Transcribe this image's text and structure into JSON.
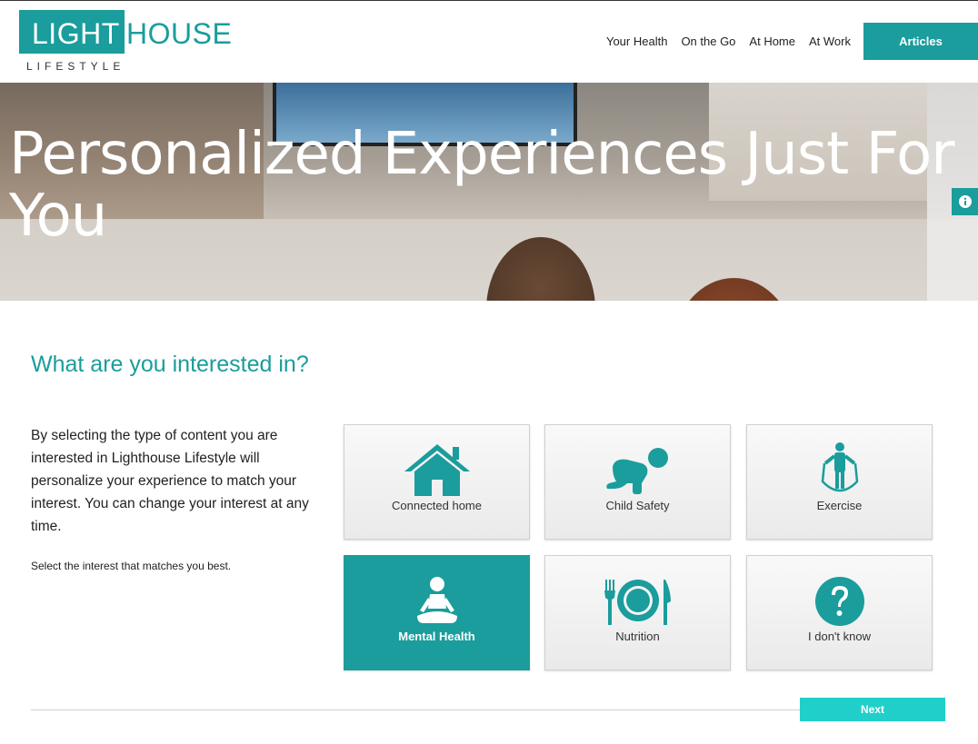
{
  "brand": {
    "logo_part1": "LIGHT",
    "logo_part2": "HOUSE",
    "logo_sub": "LIFESTYLE",
    "accent_color": "#1a9d9c"
  },
  "nav": {
    "items": [
      "Your Health",
      "On the Go",
      "At Home",
      "At Work"
    ],
    "cta_label": "Articles"
  },
  "hero": {
    "title": "Personalized Experiences Just For You",
    "info_icon": "info-icon"
  },
  "main": {
    "heading": "What are you interested in?",
    "intro": "By selecting the type of content you are interested in Lighthouse Lifestyle will personalize your experience to match your interest. You can change your interest at any time.",
    "hint": "Select the interest that matches you best."
  },
  "interests": [
    {
      "label": "Connected home",
      "icon": "house-icon",
      "selected": false
    },
    {
      "label": "Child Safety",
      "icon": "crawling-baby-icon",
      "selected": false
    },
    {
      "label": "Exercise",
      "icon": "jump-rope-icon",
      "selected": false
    },
    {
      "label": "Mental Health",
      "icon": "meditation-icon",
      "selected": true
    },
    {
      "label": "Nutrition",
      "icon": "plate-cutlery-icon",
      "selected": false
    },
    {
      "label": "I don't know",
      "icon": "question-icon",
      "selected": false
    }
  ],
  "footer": {
    "next_label": "Next",
    "next_color": "#21cfca"
  }
}
